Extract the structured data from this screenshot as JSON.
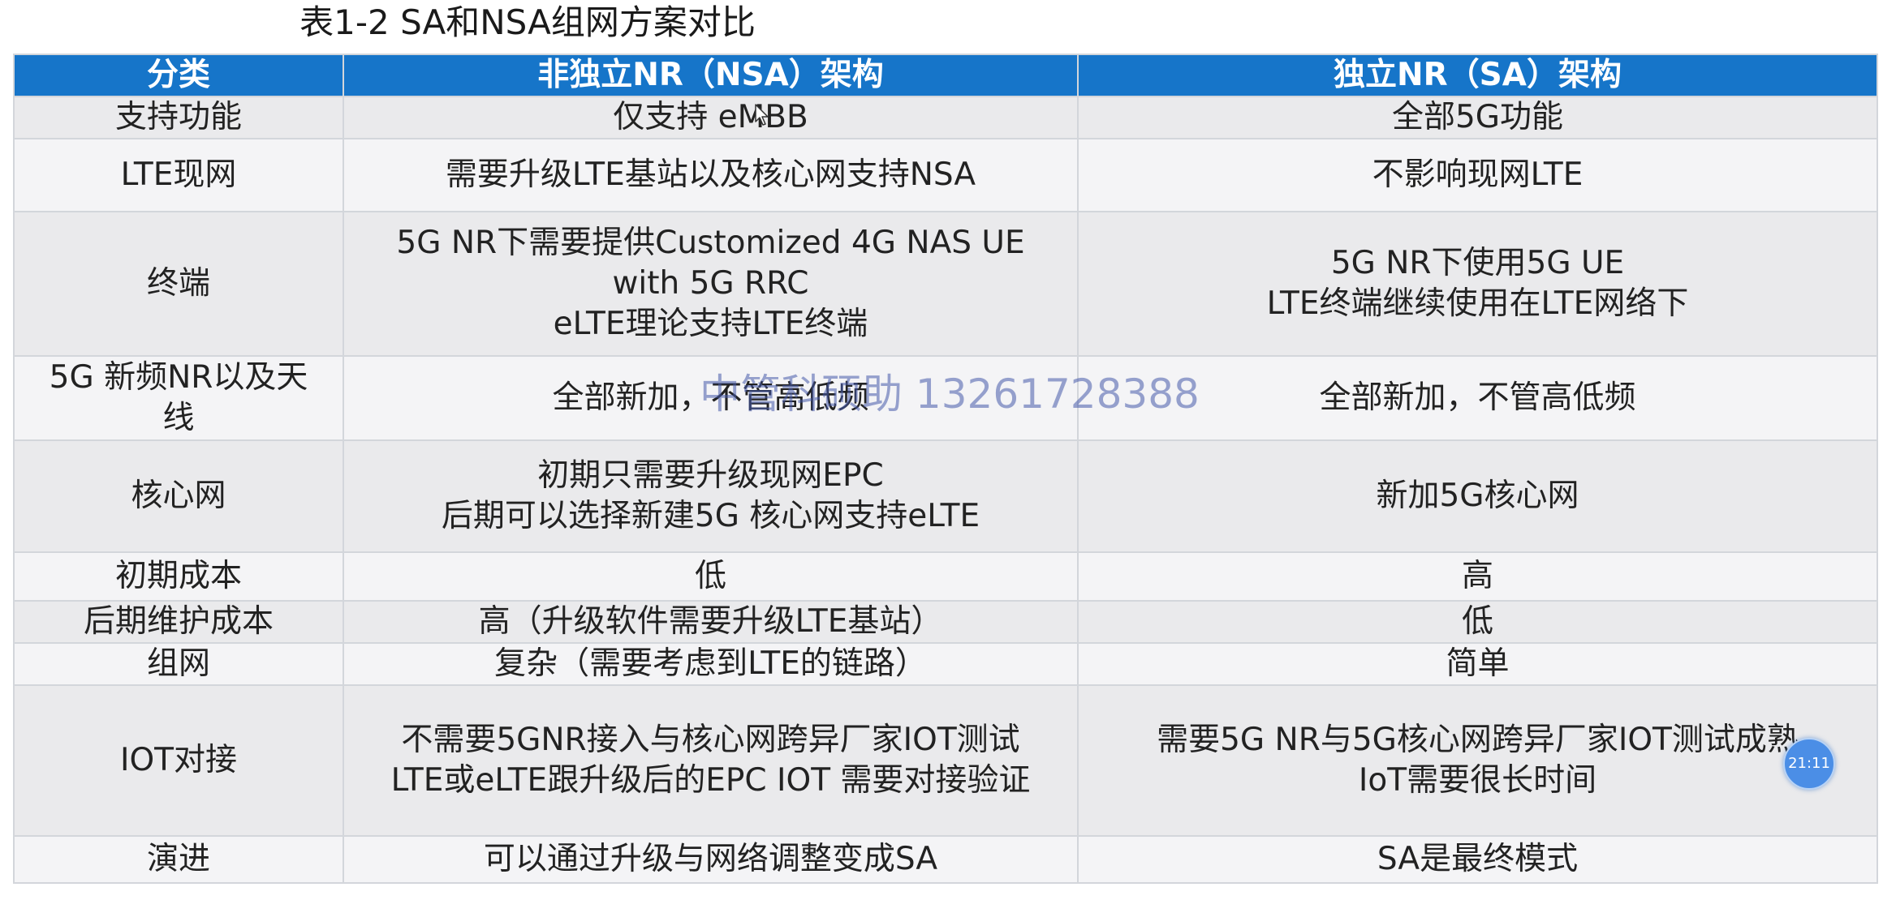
{
  "caption": "表1-2  SA和NSA组网方案对比",
  "table": {
    "headers": [
      "分类",
      "非独立NR（NSA）架构",
      "独立NR（SA）架构"
    ],
    "rows": [
      [
        "支持功能",
        "仅支持 eMBB",
        "全部5G功能"
      ],
      [
        "LTE现网",
        "需要升级LTE基站以及核心网支持NSA",
        "不影响现网LTE"
      ],
      [
        "终端",
        "5G NR下需要提供Customized 4G NAS UE\nwith 5G RRC\neLTE理论支持LTE终端",
        "5G NR下使用5G UE\nLTE终端继续使用在LTE网络下"
      ],
      [
        "5G 新频NR以及天\n线",
        "全部新加，不管高低频",
        "全部新加，不管高低频"
      ],
      [
        "核心网",
        "初期只需要升级现网EPC\n后期可以选择新建5G 核心网支持eLTE",
        "新加5G核心网"
      ],
      [
        "初期成本",
        "低",
        "高"
      ],
      [
        "后期维护成本",
        "高（升级软件需要升级LTE基站）",
        "低"
      ],
      [
        "组网",
        "复杂（需要考虑到LTE的链路）",
        "简单"
      ],
      [
        "IOT对接",
        "不需要5GNR接入与核心网跨异厂家IOT测试\nLTE或eLTE跟升级后的EPC IOT 需要对接验证",
        "需要5G NR与5G核心网跨异厂家IOT测试成熟\nIoT需要很长时间"
      ],
      [
        "演进",
        "可以通过升级与网络调整变成SA",
        "SA是最终模式"
      ]
    ]
  },
  "watermark": "中管科硕助 13261728388",
  "timer_badge": "21:11",
  "colors": {
    "header_bg": "#1675c9",
    "header_text": "#ffffff",
    "row_bg": "#eaeaec",
    "grid": "#d3d6db"
  },
  "icons": {
    "cursor": "mouse-pointer-icon"
  }
}
